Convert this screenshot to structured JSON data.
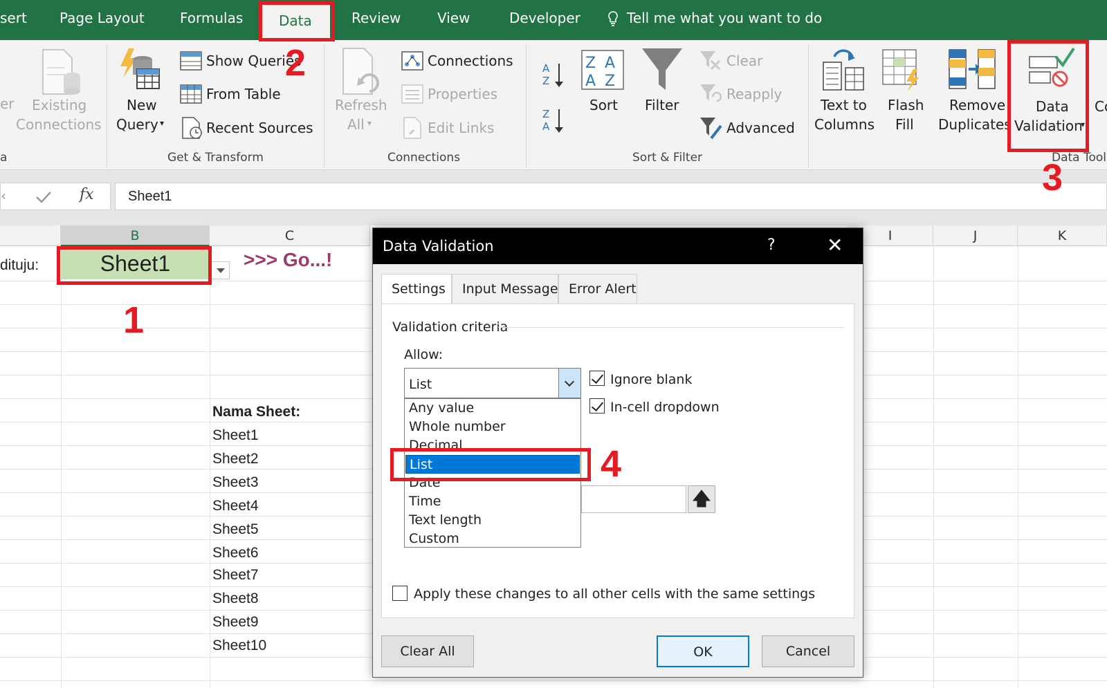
{
  "ribbon_tabs": [
    "sert",
    "Page Layout",
    "Formulas",
    "Data",
    "Review",
    "View",
    "Developer"
  ],
  "tell_me": "Tell me what you want to do",
  "ribbon": {
    "left_partial": [
      "er",
      "a"
    ],
    "existing_connections": [
      "Existing",
      "Connections"
    ],
    "new_query": [
      "New",
      "Query"
    ],
    "show_queries": "Show Queries",
    "from_table": "From Table",
    "recent_sources": "Recent Sources",
    "get_transform_label": "Get & Transform",
    "refresh_all": [
      "Refresh",
      "All"
    ],
    "connections": "Connections",
    "properties": "Properties",
    "edit_links": "Edit Links",
    "connections_label": "Connections",
    "sort": "Sort",
    "filter": "Filter",
    "clear": "Clear",
    "reapply": "Reapply",
    "advanced": "Advanced",
    "sort_filter_label": "Sort & Filter",
    "text_to_columns": [
      "Text to",
      "Columns"
    ],
    "flash_fill": [
      "Flash",
      "Fill"
    ],
    "remove_duplicates": [
      "Remove",
      "Duplicates"
    ],
    "data_validation": [
      "Data",
      "Validation"
    ],
    "data_tools_label": "Data Tools",
    "partial_right": "Co"
  },
  "formula_bar": {
    "value": "Sheet1",
    "fx": "fx"
  },
  "columns": [
    {
      "label": "B",
      "selected": true
    },
    {
      "label": "C"
    },
    {
      "label": "I"
    },
    {
      "label": "J"
    },
    {
      "label": "K"
    }
  ],
  "cells": {
    "row_label": "dituju:",
    "b_value": "Sheet1",
    "go_text": ">>> Go...!",
    "header": "Nama Sheet:",
    "sheets": [
      "Sheet1",
      "Sheet2",
      "Sheet3",
      "Sheet4",
      "Sheet5",
      "Sheet6",
      "Sheet7",
      "Sheet8",
      "Sheet9",
      "Sheet10"
    ]
  },
  "annotations": [
    "1",
    "2",
    "3",
    "4"
  ],
  "dialog": {
    "title": "Data Validation",
    "help": "?",
    "close": "✕",
    "tabs": [
      "Settings",
      "Input Message",
      "Error Alert"
    ],
    "criteria_label": "Validation criteria",
    "allow_label": "Allow:",
    "allow_value": "List",
    "options": [
      "Any value",
      "Whole number",
      "Decimal",
      "List",
      "Date",
      "Time",
      "Text length",
      "Custom"
    ],
    "selected_option": "List",
    "ignore_blank": "Ignore blank",
    "in_cell_dropdown": "In-cell dropdown",
    "apply_all": "Apply these changes to all other cells with the same settings",
    "clear_all": "Clear All",
    "ok": "OK",
    "cancel": "Cancel"
  },
  "colors": {
    "excel_green": "#217346",
    "highlight": "#e51b24",
    "selection_blue": "#0078d7",
    "cell_fill": "#c6e0b4"
  }
}
